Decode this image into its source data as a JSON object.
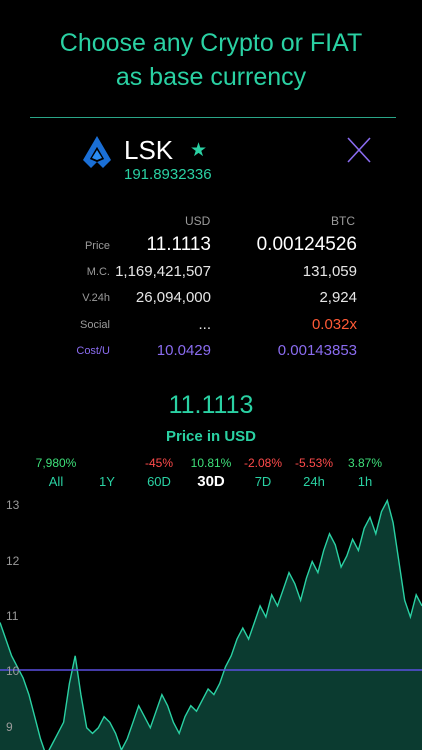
{
  "headline": {
    "line1": "Choose any Crypto or FIAT",
    "line2": "as base currency"
  },
  "coin": {
    "symbol": "LSK",
    "amount": "191.8932336",
    "favorite": true,
    "icon": "lisk-logo-icon"
  },
  "columns": {
    "usd": "USD",
    "btc": "BTC"
  },
  "rows": [
    {
      "label": "Price",
      "usd": "11.1113",
      "btc": "0.00124526"
    },
    {
      "label": "M.C.",
      "usd": "1,169,421,507",
      "btc": "131,059"
    },
    {
      "label": "V.24h",
      "usd": "26,094,000",
      "btc": "2,924"
    },
    {
      "label": "Social",
      "usd": "...",
      "btc": "0.032x"
    },
    {
      "label": "Cost/U",
      "usd": "10.0429",
      "btc": "0.00143853"
    }
  ],
  "price": {
    "value": "11.1113",
    "label": "Price in USD"
  },
  "ranges": [
    {
      "label": "All",
      "change": "7,980%"
    },
    {
      "label": "1Y",
      "change": ""
    },
    {
      "label": "60D",
      "change": "-45%"
    },
    {
      "label": "30D",
      "change": "10.81%"
    },
    {
      "label": "7D",
      "change": "-2.08%"
    },
    {
      "label": "24h",
      "change": "-5.53%"
    },
    {
      "label": "1h",
      "change": "3.87%"
    }
  ],
  "active_range": "30D",
  "colors": {
    "accent": "#2ad1a3",
    "negative": "#ff4b4b",
    "positive": "#3ee07a",
    "purple": "#8a6cf0",
    "social": "#ff5a36",
    "costline": "#5b4fe0"
  },
  "chart_data": {
    "type": "area",
    "ytick_labels": [
      "13",
      "12",
      "11",
      "10",
      "9"
    ],
    "ylim": [
      8.6,
      13.2
    ],
    "reference_line": 10.0429,
    "series": [
      {
        "values": [
          10.9,
          10.6,
          10.3,
          10.1,
          9.9,
          9.6,
          9.2,
          8.8,
          8.5,
          8.7,
          8.9,
          9.1,
          9.8,
          10.3,
          9.6,
          9.0,
          8.9,
          9.0,
          9.2,
          9.1,
          8.9,
          8.6,
          8.8,
          9.1,
          9.4,
          9.2,
          9.0,
          9.3,
          9.6,
          9.4,
          9.1,
          8.9,
          9.2,
          9.4,
          9.3,
          9.5,
          9.7,
          9.6,
          9.8,
          10.1,
          10.3,
          10.6,
          10.8,
          10.6,
          10.9,
          11.2,
          11.0,
          11.4,
          11.2,
          11.5,
          11.8,
          11.6,
          11.3,
          11.7,
          12.0,
          11.8,
          12.2,
          12.5,
          12.3,
          11.9,
          12.1,
          12.4,
          12.2,
          12.6,
          12.8,
          12.5,
          12.9,
          13.1,
          12.7,
          12.0,
          11.3,
          11.0,
          11.4,
          11.2
        ]
      }
    ]
  }
}
